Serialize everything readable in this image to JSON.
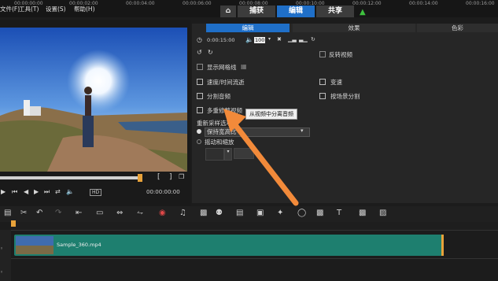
{
  "menubar": {
    "items": [
      "文件(F)",
      "工具(T)",
      "设置(S)",
      "帮助(H)"
    ]
  },
  "workspace_tabs": {
    "capture": "捕获",
    "edit": "编辑",
    "share": "共享"
  },
  "preview": {
    "timecode": "00:00:00:00",
    "bracket_in": "[",
    "bracket_out": "]",
    "zoom_label": "HD"
  },
  "options_panel": {
    "tabs": [
      "编辑",
      "效果",
      "色彩"
    ],
    "duration": "0:00:15:00",
    "volume": "100",
    "flip_video": "反转视频",
    "show_grid": "显示网格线",
    "speed_timelapse": "速度/时间流逝",
    "variable_speed": "变速",
    "split_audio": "分割音频",
    "split_by_scene": "按场景分割",
    "multi_trim": "多重修整视频",
    "tooltip": "从视频中分离音频",
    "resample_label": "重新采样选项",
    "resample_value": "保持宽高比",
    "pan_zoom": "摇动和缩放"
  },
  "timeline": {
    "ruler": [
      "00:00:00:00",
      "00:00:02:00",
      "00:00:04:00",
      "00:00:06:00",
      "00:00:08:00",
      "00:00:10:00",
      "00:00:12:00",
      "00:00:14:00",
      "00:00:16:00"
    ],
    "clip_name": "Sample_360.mp4"
  },
  "colors": {
    "accent": "#1f6fc8",
    "clip": "#1e7f6f",
    "arrow": "#f28a3a",
    "tab_dark": "#3c3c3c"
  }
}
